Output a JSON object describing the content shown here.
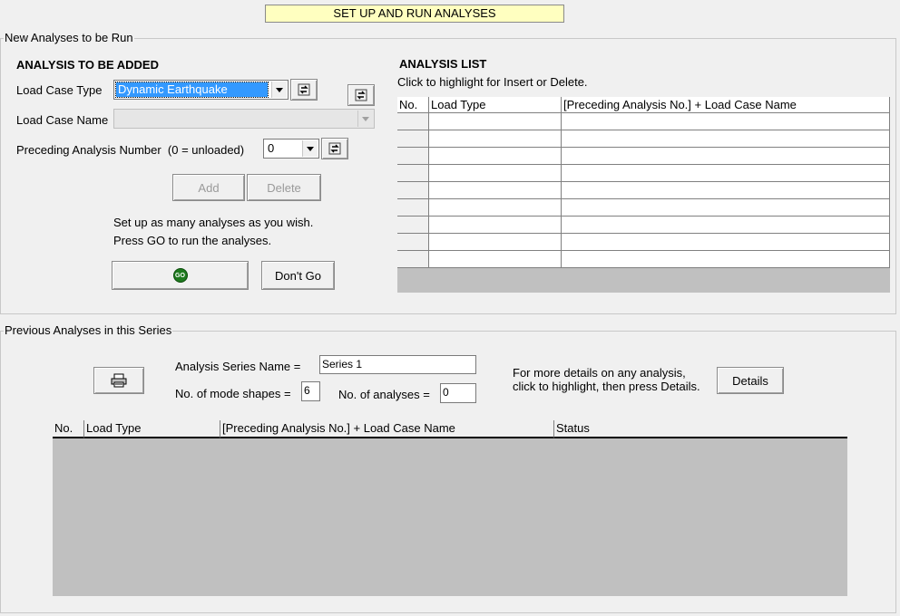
{
  "banner": "SET UP AND RUN ANALYSES",
  "new_group": {
    "title": "New Analyses to be Run",
    "add_heading": "ANALYSIS TO BE ADDED",
    "load_case_type_label": "Load Case Type",
    "load_case_type_value": "Dynamic Earthquake",
    "load_case_name_label": "Load Case Name",
    "preceding_label": "Preceding Analysis Number  (0 = unloaded)",
    "preceding_value": "0",
    "add_label": "Add",
    "delete_label": "Delete",
    "help_line1": "Set up as many analyses as you wish.",
    "help_line2": "Press GO to run the analyses.",
    "go_label": "GO",
    "dont_go_label": "Don't Go",
    "list_heading": "ANALYSIS LIST",
    "list_hint": "Click to highlight for Insert or Delete.",
    "list_columns": [
      "No.",
      "Load Type",
      "[Preceding Analysis No.] + Load Case Name"
    ]
  },
  "prev_group": {
    "title": "Previous Analyses in this Series",
    "series_name_label": "Analysis Series Name =",
    "series_name_value": "Series 1",
    "mode_shapes_label": "No. of mode shapes =",
    "mode_shapes_value": "6",
    "num_analyses_label": "No. of analyses =",
    "num_analyses_value": "0",
    "details_hint_line1": "For more details on any analysis,",
    "details_hint_line2": "click to highlight, then press Details.",
    "details_label": "Details",
    "columns": [
      "No.",
      "Load Type",
      "[Preceding Analysis No.] + Load Case Name",
      "Status"
    ]
  },
  "colors": {
    "banner_bg": "#ffffc0",
    "selection": "#3399ff",
    "grid_empty": "#c0c0c0",
    "go_icon": "#1e7a1e"
  }
}
